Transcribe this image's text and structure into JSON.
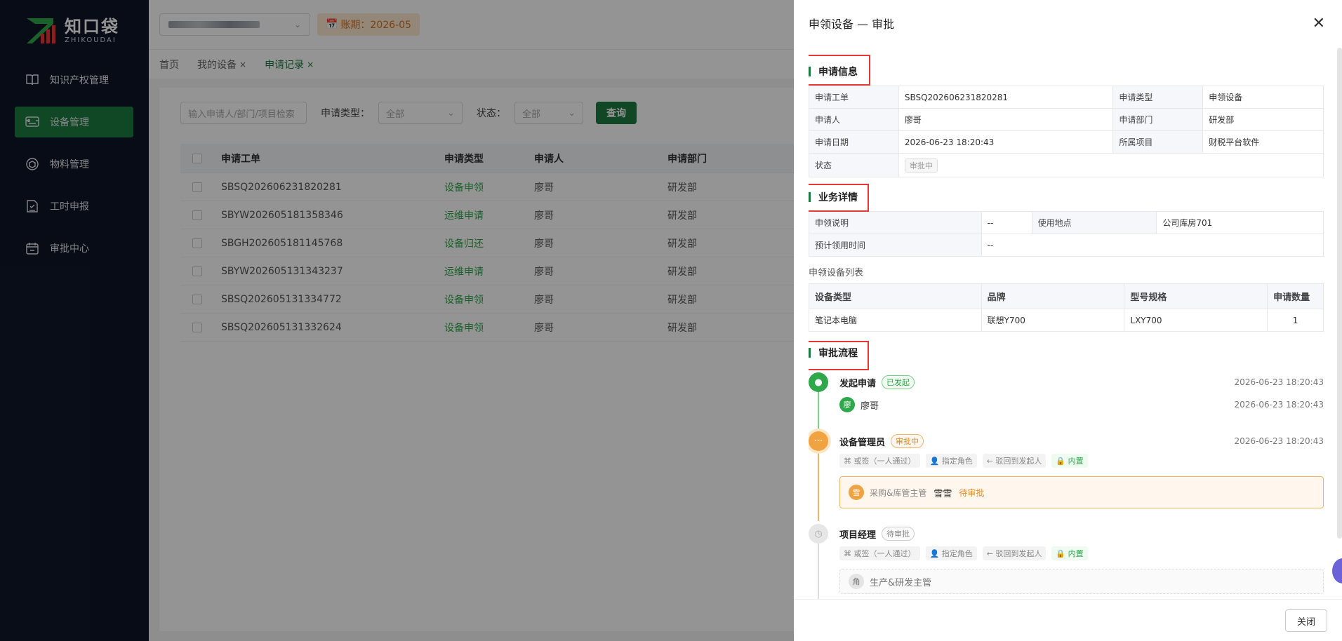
{
  "logo": {
    "cn": "知口袋",
    "en": "ZHIKOUDAI"
  },
  "sidebar": {
    "items": [
      {
        "label": "知识产权管理",
        "icon": "book-icon"
      },
      {
        "label": "设备管理",
        "icon": "device-icon",
        "active": true
      },
      {
        "label": "物料管理",
        "icon": "box-icon"
      },
      {
        "label": "工时申报",
        "icon": "timesheet-icon"
      },
      {
        "label": "审批中心",
        "icon": "calendar-check-icon"
      }
    ]
  },
  "topbar": {
    "period": "账期：2026-05"
  },
  "tabs": [
    {
      "label": "首页"
    },
    {
      "label": "我的设备",
      "closable": true
    },
    {
      "label": "申请记录",
      "closable": true,
      "active": true
    }
  ],
  "filters": {
    "search_placeholder": "输入申请人/部门/项目检索",
    "type_label": "申请类型：",
    "type_value": "全部",
    "status_label": "状态：",
    "status_value": "全部",
    "query_label": "查询"
  },
  "table": {
    "columns": [
      "申请工单",
      "申请类型",
      "申请人",
      "申请部门"
    ],
    "rows": [
      [
        "SBSQ202606231820281",
        "设备申领",
        "廖哥",
        "研发部"
      ],
      [
        "SBYW202605181358346",
        "运维申请",
        "廖哥",
        "研发部"
      ],
      [
        "SBGH202605181145768",
        "设备归还",
        "廖哥",
        "研发部"
      ],
      [
        "SBYW202605131343237",
        "运维申请",
        "廖哥",
        "研发部"
      ],
      [
        "SBSQ202605131334772",
        "设备申领",
        "廖哥",
        "研发部"
      ],
      [
        "SBSQ202605131332624",
        "设备申领",
        "廖哥",
        "研发部"
      ]
    ]
  },
  "drawer": {
    "title": "申领设备 — 审批",
    "close_label": "关闭",
    "apply_info": {
      "title": "申请信息",
      "order_label": "申请工单",
      "order": "SBSQ202606231820281",
      "type_label": "申请类型",
      "type": "申领设备",
      "applicant_label": "申请人",
      "applicant": "廖哥",
      "dept_label": "申请部门",
      "dept": "研发部",
      "date_label": "申请日期",
      "date": "2026-06-23 18:20:43",
      "project_label": "所属项目",
      "project": "财税平台软件",
      "status_label": "状态",
      "status": "审批中"
    },
    "business": {
      "title": "业务详情",
      "desc_label": "申领说明",
      "desc": "--",
      "location_label": "使用地点",
      "location": "公司库房701",
      "time_label": "预计领用时间",
      "time": "--",
      "list_label": "申领设备列表",
      "columns": [
        "设备类型",
        "品牌",
        "型号规格",
        "申请数量"
      ],
      "rows": [
        [
          "笔记本电脑",
          "联想Y700",
          "LXY700",
          "1"
        ]
      ]
    },
    "flow": {
      "title": "审批流程",
      "nodes": [
        {
          "name": "发起申请",
          "status": "已发起",
          "time": "2026-06-23 18:20:43",
          "person_avatar": "廖",
          "person": "廖哥",
          "person_time": "2026-06-23 18:20:43"
        },
        {
          "name": "设备管理员",
          "status": "审批中",
          "time": "2026-06-23 18:20:43",
          "chips": [
            "或签（一人通过）",
            "指定角色",
            "驳回到发起人",
            "内置"
          ],
          "approver_avatar": "雪",
          "approver_role": "采购&库管主管",
          "approver_name": "雪雪",
          "approver_status": "待审批"
        },
        {
          "name": "项目经理",
          "status": "待审批",
          "chips": [
            "或签（一人通过）",
            "指定角色",
            "驳回到发起人",
            "内置"
          ],
          "role_avatar": "角",
          "role_name": "生产&研发主管"
        }
      ]
    }
  }
}
